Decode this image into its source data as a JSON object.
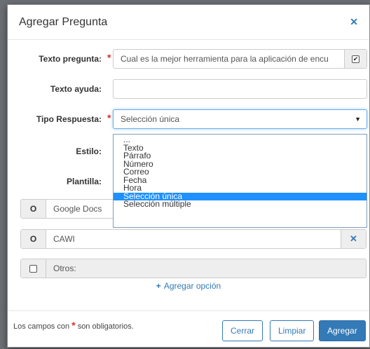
{
  "modal": {
    "title": "Agregar Pregunta",
    "close_icon": "close-icon"
  },
  "form": {
    "texto_pregunta": {
      "label": "Texto pregunta:",
      "value": "Cual es la mejor herramienta para la aplicación de encu",
      "required": true
    },
    "texto_ayuda": {
      "label": "Texto ayuda:",
      "value": ""
    },
    "tipo_respuesta": {
      "label": "Tipo Respuesta:",
      "value": "Selección única",
      "required": true,
      "options": [
        "...",
        "Texto",
        "Párrafo",
        "Número",
        "Correo",
        "Fecha",
        "Hora",
        "Selección única",
        "Selección múltiple"
      ],
      "selected_index": 7
    },
    "estilo": {
      "label": "Estilo:"
    },
    "plantilla": {
      "label": "Plantilla:"
    }
  },
  "options_list": [
    {
      "marker": "O",
      "text": "Google Docs",
      "removable": false
    },
    {
      "marker": "O",
      "text": "CAWI",
      "removable": true
    },
    {
      "marker": "checkbox",
      "text": "Otros:",
      "disabled": true
    }
  ],
  "add_option": {
    "label": "Agregar opción",
    "icon": "plus-icon"
  },
  "footer": {
    "note_prefix": "Los campos con",
    "note_star": "*",
    "note_suffix": "son obligatorios.",
    "buttons": {
      "cerrar": "Cerrar",
      "limpiar": "Limpiar",
      "agregar": "Agregar"
    }
  },
  "colors": {
    "primary": "#337ab7",
    "required": "#d9302c",
    "selected": "#1e90ff"
  }
}
